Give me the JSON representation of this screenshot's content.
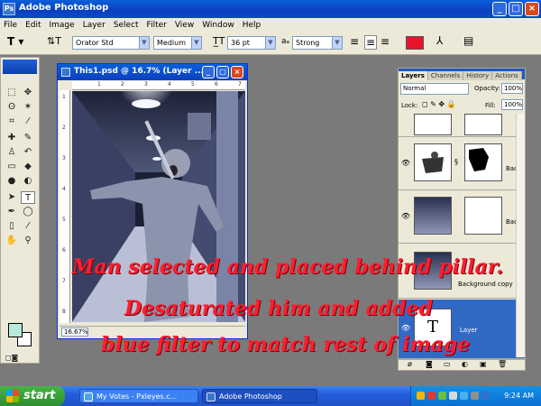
{
  "window": {
    "title": "Adobe Photoshop"
  },
  "menu": [
    "File",
    "Edit",
    "Image",
    "Layer",
    "Select",
    "Filter",
    "View",
    "Window",
    "Help"
  ],
  "options_bar": {
    "font_family": "Orator Std",
    "font_style": "Medium",
    "font_size": "36 pt",
    "antialias": "Strong",
    "text_color": "#e8142e"
  },
  "document": {
    "title": "This1.psd @ 16.7% (Layer ...",
    "zoom": "16.67%",
    "ruler_top": [
      "1",
      "2",
      "3",
      "4",
      "5",
      "6",
      "7"
    ],
    "ruler_left": [
      "1",
      "2",
      "3",
      "4",
      "5",
      "6",
      "7",
      "8"
    ]
  },
  "layers_panel": {
    "tabs": [
      "Layers",
      "Channels",
      "History",
      "Actions"
    ],
    "blend_mode": "Normal",
    "opacity_label": "Opacity:",
    "opacity": "100%",
    "lock_label": "Lock:",
    "fill_label": "Fill:",
    "fill": "100%",
    "layers": [
      {
        "name": "",
        "visible": false
      },
      {
        "name": "Bac...",
        "visible": true
      },
      {
        "name": "Bac...",
        "visible": true
      },
      {
        "name": "Background copy",
        "visible": false
      },
      {
        "name": "Layer",
        "visible": true,
        "selected": true
      }
    ]
  },
  "caption": {
    "line1": "Man selected and placed behind pillar.",
    "line2": "Desaturated him and added",
    "line3": "blue filter to match rest of image",
    "color": "#ff1e2e"
  },
  "taskbar": {
    "start_label": "start",
    "tasks": [
      "My Votes - Pxleyes.c...",
      "Adobe Photoshop"
    ],
    "clock": "9:24 AM"
  }
}
